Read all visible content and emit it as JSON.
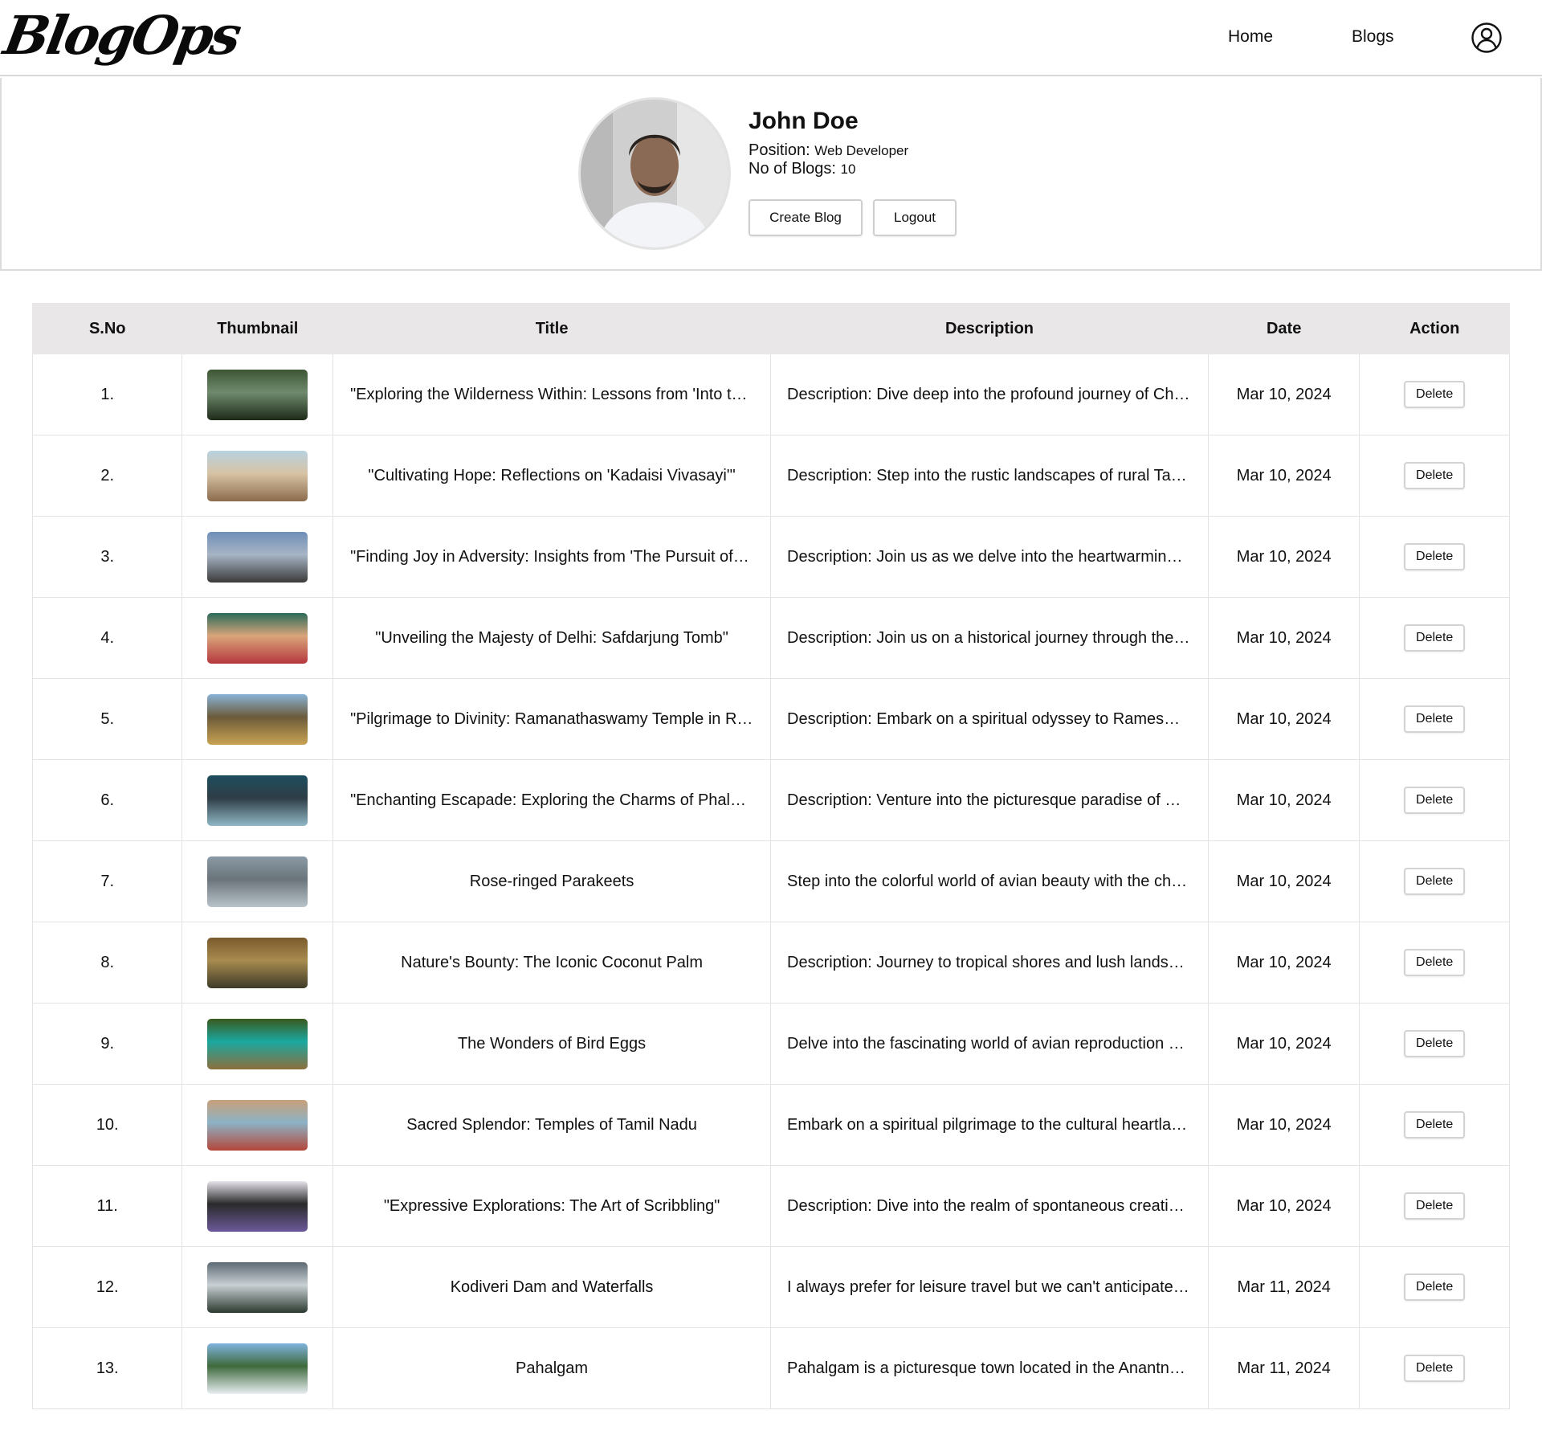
{
  "nav": {
    "logo": "BlogOps",
    "links": [
      "Home",
      "Blogs"
    ],
    "user_icon": "user-circle-icon"
  },
  "profile": {
    "name": "John Doe",
    "position_label": "Position:",
    "position_value": "Web Developer",
    "blogs_label": "No of Blogs:",
    "blogs_value": "10",
    "create_button": "Create Blog",
    "logout_button": "Logout"
  },
  "table": {
    "headers": [
      "S.No",
      "Thumbnail",
      "Title",
      "Description",
      "Date",
      "Action"
    ],
    "rows": [
      {
        "sno": "1.",
        "title": "\"Exploring the Wilderness Within: Lessons from 'Into the Wild'\"",
        "description": "Description: Dive deep into the profound journey of Christopher McCandless",
        "date": "Mar 10, 2024",
        "action": "Delete",
        "thumb": [
          "#3d5634",
          "#1e2a18",
          "#6f8a6e"
        ]
      },
      {
        "sno": "2.",
        "title": "\"Cultivating Hope: Reflections on 'Kadaisi Vivasayi'\"",
        "description": "Description: Step into the rustic landscapes of rural Tamil Nadu",
        "date": "Mar 10, 2024",
        "action": "Delete",
        "thumb": [
          "#b7d2e0",
          "#8b6b4c",
          "#d8c3a5"
        ]
      },
      {
        "sno": "3.",
        "title": "\"Finding Joy in Adversity: Insights from 'The Pursuit of Happyness'\"",
        "description": "Description: Join us as we delve into the heartwarming story",
        "date": "Mar 10, 2024",
        "action": "Delete",
        "thumb": [
          "#6f8fb8",
          "#3a3a3a",
          "#a7b4c4"
        ]
      },
      {
        "sno": "4.",
        "title": "\"Unveiling the Majesty of Delhi: Safdarjung Tomb\"",
        "description": "Description: Join us on a historical journey through the heart of Delhi",
        "date": "Mar 10, 2024",
        "action": "Delete",
        "thumb": [
          "#2a6a5a",
          "#b5373e",
          "#d9a57a"
        ]
      },
      {
        "sno": "5.",
        "title": "\"Pilgrimage to Divinity: Ramanathaswamy Temple in Rameswaram\"",
        "description": "Description: Embark on a spiritual odyssey to Rameswaram",
        "date": "Mar 10, 2024",
        "action": "Delete",
        "thumb": [
          "#89b3d6",
          "#c9a352",
          "#6b5a3a"
        ]
      },
      {
        "sno": "6.",
        "title": "\"Enchanting Escapade: Exploring the Charms of Phalgam\"",
        "description": "Description: Venture into the picturesque paradise of Pahalgam",
        "date": "Mar 10, 2024",
        "action": "Delete",
        "thumb": [
          "#1d4e5e",
          "#8fb8c6",
          "#2f3d46"
        ]
      },
      {
        "sno": "7.",
        "title": "Rose-ringed Parakeets",
        "description": "Step into the colorful world of avian beauty with the charming parakeets",
        "date": "Mar 10, 2024",
        "action": "Delete",
        "thumb": [
          "#8a9aa6",
          "#b9c4ca",
          "#6a747a"
        ]
      },
      {
        "sno": "8.",
        "title": "Nature's Bounty: The Iconic Coconut Palm",
        "description": "Description: Journey to tropical shores and lush landscapes",
        "date": "Mar 10, 2024",
        "action": "Delete",
        "thumb": [
          "#7a5a2c",
          "#3e3b2a",
          "#a88b4f"
        ]
      },
      {
        "sno": "9.",
        "title": "The Wonders of Bird Eggs",
        "description": "Delve into the fascinating world of avian reproduction and nests",
        "date": "Mar 10, 2024",
        "action": "Delete",
        "thumb": [
          "#3b5a1e",
          "#8d6e3c",
          "#1aa8a0"
        ]
      },
      {
        "sno": "10.",
        "title": "Sacred Splendor: Temples of Tamil Nadu",
        "description": "Embark on a spiritual pilgrimage to the cultural heartland of Tamil Nadu",
        "date": "Mar 10, 2024",
        "action": "Delete",
        "thumb": [
          "#c9a07a",
          "#b4473a",
          "#8cb2c6"
        ]
      },
      {
        "sno": "11.",
        "title": "\"Expressive Explorations: The Art of Scribbling\"",
        "description": "Description: Dive into the realm of spontaneous creativity",
        "date": "Mar 10, 2024",
        "action": "Delete",
        "thumb": [
          "#e7e4ec",
          "#6d5a9a",
          "#2a2a2a"
        ]
      },
      {
        "sno": "12.",
        "title": "Kodiveri Dam and Waterfalls",
        "description": "I always prefer for leisure travel but we can't anticipate every turn",
        "date": "Mar 11, 2024",
        "action": "Delete",
        "thumb": [
          "#5d6a74",
          "#2c3a30",
          "#c9d0d4"
        ]
      },
      {
        "sno": "13.",
        "title": "Pahalgam",
        "description": "Pahalgam is a picturesque town located in the Anantnag district",
        "date": "Mar 11, 2024",
        "action": "Delete",
        "thumb": [
          "#7fb3de",
          "#e8eef2",
          "#3f6a3c"
        ]
      }
    ]
  }
}
